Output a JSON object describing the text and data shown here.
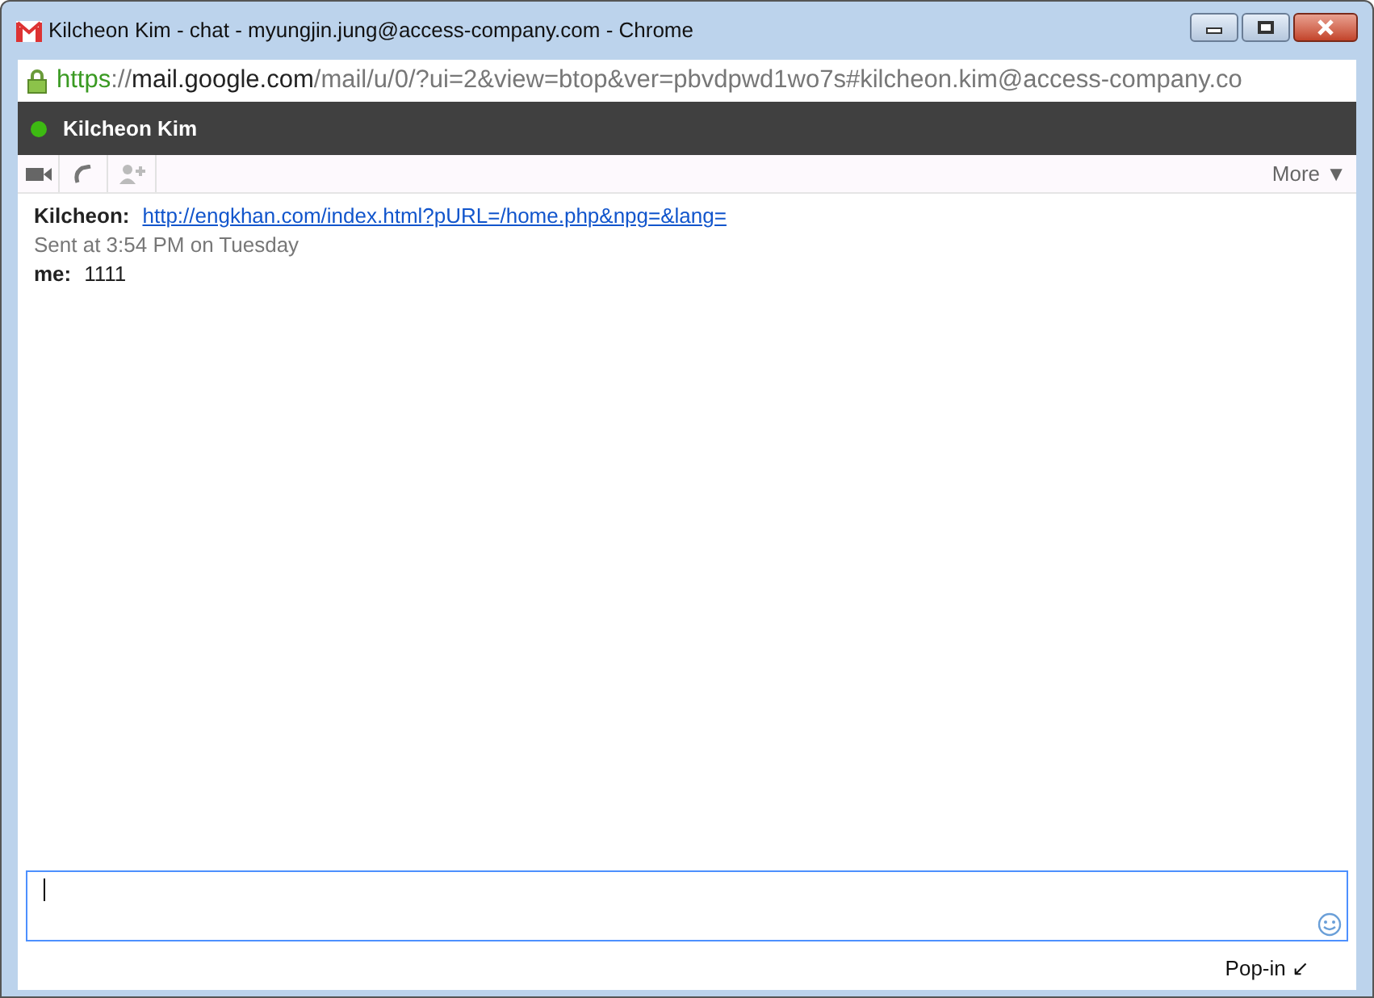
{
  "window": {
    "title": "Kilcheon Kim - chat - myungjin.jung@access-company.com - Chrome"
  },
  "address_bar": {
    "url_parts": [
      {
        "kind": "scheme",
        "text": "https"
      },
      {
        "kind": "path",
        "text": "://"
      },
      {
        "kind": "host",
        "text": "mail.google.com"
      },
      {
        "kind": "path",
        "text": "/mail/u/0/?ui=2&view=btop&ver=pbvdpwd1wo7s#kilcheon.kim@access-company.co"
      }
    ]
  },
  "chat_header": {
    "name": "Kilcheon Kim",
    "online": true
  },
  "toolbar": {
    "more": "More ▼"
  },
  "messages": [
    {
      "kind": "message",
      "sender": "Kilcheon:",
      "text": "http://engkhan.com/index.html?pURL=/home.php&npg=&lang=",
      "link": true
    },
    {
      "kind": "timestamp",
      "text": "Sent at 3:54 PM on Tuesday"
    },
    {
      "kind": "message",
      "sender": "me:",
      "text": "1111",
      "link": false
    }
  ],
  "footer": {
    "pop_in": "Pop-in ↙"
  }
}
